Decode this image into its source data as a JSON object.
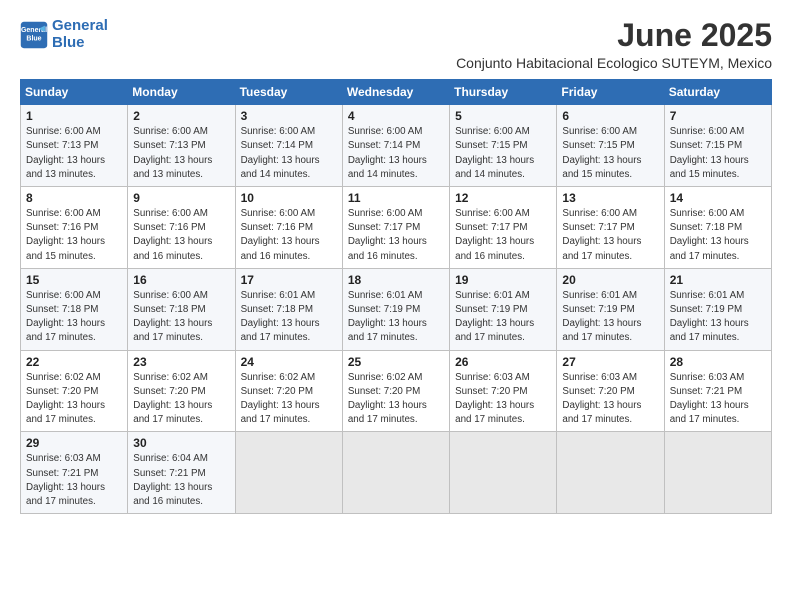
{
  "header": {
    "logo_line1": "General",
    "logo_line2": "Blue",
    "title": "June 2025",
    "subtitle": "Conjunto Habitacional Ecologico SUTEYM, Mexico"
  },
  "weekdays": [
    "Sunday",
    "Monday",
    "Tuesday",
    "Wednesday",
    "Thursday",
    "Friday",
    "Saturday"
  ],
  "weeks": [
    [
      {
        "day": 1,
        "rise": "6:00 AM",
        "set": "7:13 PM",
        "hours": "13 hours and 13 minutes."
      },
      {
        "day": 2,
        "rise": "6:00 AM",
        "set": "7:13 PM",
        "hours": "13 hours and 13 minutes."
      },
      {
        "day": 3,
        "rise": "6:00 AM",
        "set": "7:14 PM",
        "hours": "13 hours and 14 minutes."
      },
      {
        "day": 4,
        "rise": "6:00 AM",
        "set": "7:14 PM",
        "hours": "13 hours and 14 minutes."
      },
      {
        "day": 5,
        "rise": "6:00 AM",
        "set": "7:15 PM",
        "hours": "13 hours and 14 minutes."
      },
      {
        "day": 6,
        "rise": "6:00 AM",
        "set": "7:15 PM",
        "hours": "13 hours and 15 minutes."
      },
      {
        "day": 7,
        "rise": "6:00 AM",
        "set": "7:15 PM",
        "hours": "13 hours and 15 minutes."
      }
    ],
    [
      {
        "day": 8,
        "rise": "6:00 AM",
        "set": "7:16 PM",
        "hours": "13 hours and 15 minutes."
      },
      {
        "day": 9,
        "rise": "6:00 AM",
        "set": "7:16 PM",
        "hours": "13 hours and 16 minutes."
      },
      {
        "day": 10,
        "rise": "6:00 AM",
        "set": "7:16 PM",
        "hours": "13 hours and 16 minutes."
      },
      {
        "day": 11,
        "rise": "6:00 AM",
        "set": "7:17 PM",
        "hours": "13 hours and 16 minutes."
      },
      {
        "day": 12,
        "rise": "6:00 AM",
        "set": "7:17 PM",
        "hours": "13 hours and 16 minutes."
      },
      {
        "day": 13,
        "rise": "6:00 AM",
        "set": "7:17 PM",
        "hours": "13 hours and 17 minutes."
      },
      {
        "day": 14,
        "rise": "6:00 AM",
        "set": "7:18 PM",
        "hours": "13 hours and 17 minutes."
      }
    ],
    [
      {
        "day": 15,
        "rise": "6:00 AM",
        "set": "7:18 PM",
        "hours": "13 hours and 17 minutes."
      },
      {
        "day": 16,
        "rise": "6:00 AM",
        "set": "7:18 PM",
        "hours": "13 hours and 17 minutes."
      },
      {
        "day": 17,
        "rise": "6:01 AM",
        "set": "7:18 PM",
        "hours": "13 hours and 17 minutes."
      },
      {
        "day": 18,
        "rise": "6:01 AM",
        "set": "7:19 PM",
        "hours": "13 hours and 17 minutes."
      },
      {
        "day": 19,
        "rise": "6:01 AM",
        "set": "7:19 PM",
        "hours": "13 hours and 17 minutes."
      },
      {
        "day": 20,
        "rise": "6:01 AM",
        "set": "7:19 PM",
        "hours": "13 hours and 17 minutes."
      },
      {
        "day": 21,
        "rise": "6:01 AM",
        "set": "7:19 PM",
        "hours": "13 hours and 17 minutes."
      }
    ],
    [
      {
        "day": 22,
        "rise": "6:02 AM",
        "set": "7:20 PM",
        "hours": "13 hours and 17 minutes."
      },
      {
        "day": 23,
        "rise": "6:02 AM",
        "set": "7:20 PM",
        "hours": "13 hours and 17 minutes."
      },
      {
        "day": 24,
        "rise": "6:02 AM",
        "set": "7:20 PM",
        "hours": "13 hours and 17 minutes."
      },
      {
        "day": 25,
        "rise": "6:02 AM",
        "set": "7:20 PM",
        "hours": "13 hours and 17 minutes."
      },
      {
        "day": 26,
        "rise": "6:03 AM",
        "set": "7:20 PM",
        "hours": "13 hours and 17 minutes."
      },
      {
        "day": 27,
        "rise": "6:03 AM",
        "set": "7:20 PM",
        "hours": "13 hours and 17 minutes."
      },
      {
        "day": 28,
        "rise": "6:03 AM",
        "set": "7:21 PM",
        "hours": "13 hours and 17 minutes."
      }
    ],
    [
      {
        "day": 29,
        "rise": "6:03 AM",
        "set": "7:21 PM",
        "hours": "13 hours and 17 minutes."
      },
      {
        "day": 30,
        "rise": "6:04 AM",
        "set": "7:21 PM",
        "hours": "13 hours and 16 minutes."
      },
      null,
      null,
      null,
      null,
      null
    ]
  ]
}
